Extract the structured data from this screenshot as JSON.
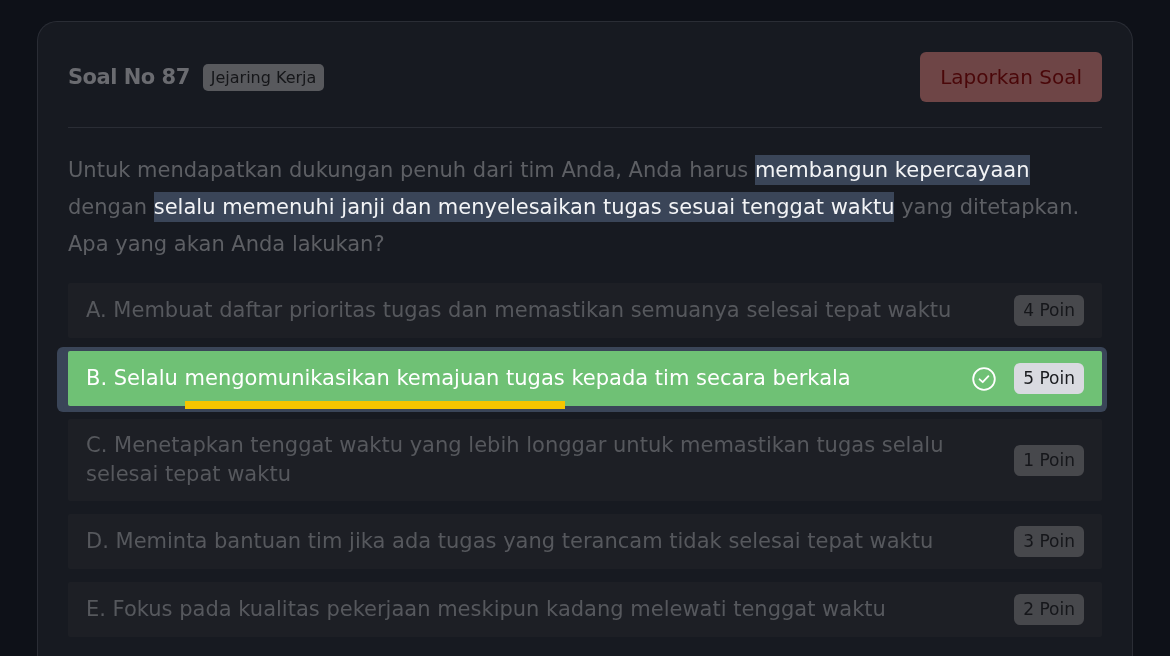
{
  "header": {
    "title": "Soal No 87",
    "category_tag": "Jejaring Kerja",
    "report_button": "Laporkan Soal"
  },
  "question": {
    "segments": [
      {
        "text": "Untuk mendapatkan dukungan penuh dari tim Anda, Anda harus ",
        "highlighted": false
      },
      {
        "text": "membangun kepercayaan",
        "highlighted": true
      },
      {
        "text": " dengan ",
        "highlighted": false
      },
      {
        "text": "selalu memenuhi janji dan menyelesaikan tugas sesuai tenggat waktu",
        "highlighted": true
      },
      {
        "text": " yang ditetapkan. Apa yang akan Anda lakukan?",
        "highlighted": false
      }
    ]
  },
  "options": [
    {
      "segments": [
        {
          "text": "A. Membuat daftar prioritas tugas dan memastikan semuanya selesai tepat waktu",
          "underlined": false
        }
      ],
      "points": "4 Poin",
      "selected": false
    },
    {
      "segments": [
        {
          "text": "B. Selalu ",
          "underlined": false
        },
        {
          "text": "mengomunikasikan kemajuan tugas",
          "underlined": true
        },
        {
          "text": " kepada tim secara berkala",
          "underlined": false
        }
      ],
      "points": "5 Poin",
      "selected": true
    },
    {
      "segments": [
        {
          "text": "C. Menetapkan tenggat waktu yang lebih longgar untuk memastikan tugas selalu selesai tepat waktu",
          "underlined": false
        }
      ],
      "points": "1 Poin",
      "selected": false
    },
    {
      "segments": [
        {
          "text": "D. Meminta bantuan tim jika ada tugas yang terancam tidak selesai tepat waktu",
          "underlined": false
        }
      ],
      "points": "3 Poin",
      "selected": false
    },
    {
      "segments": [
        {
          "text": "E. Fokus pada kualitas pekerjaan meskipun kadang melewati tenggat waktu",
          "underlined": false
        }
      ],
      "points": "2 Poin",
      "selected": false
    }
  ]
}
